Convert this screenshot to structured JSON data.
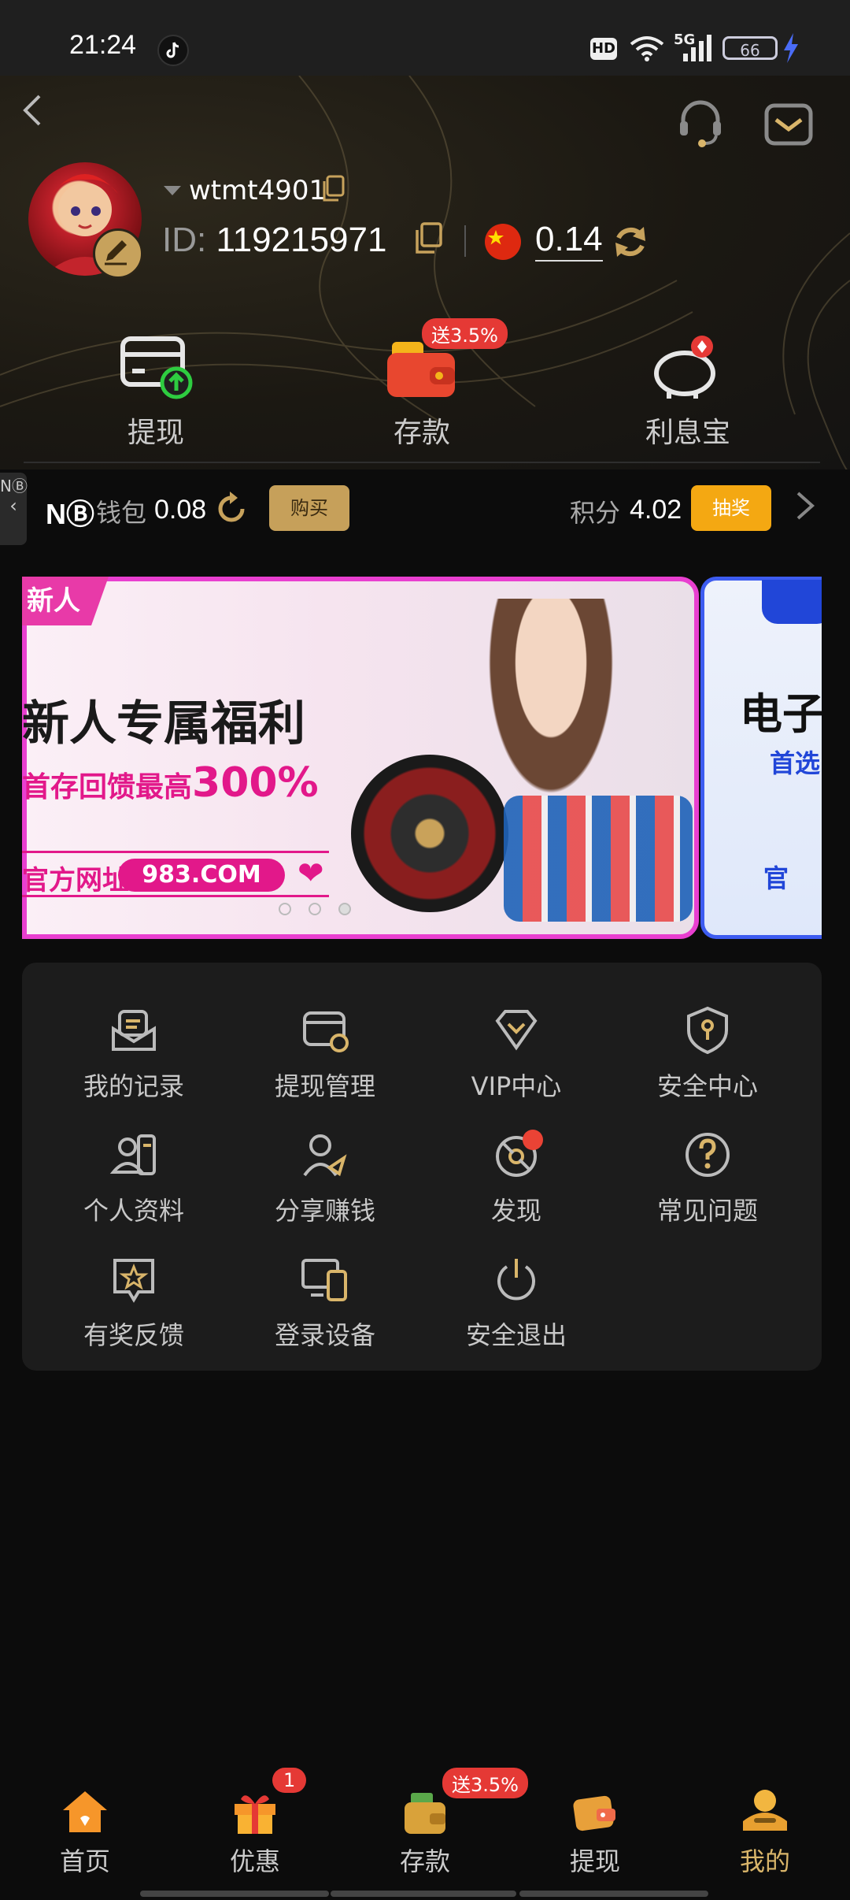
{
  "status_bar": {
    "time": "21:24",
    "hd": "HD",
    "network": "5G",
    "battery": "66"
  },
  "profile": {
    "username": "wtmt4901",
    "id_label": "ID:",
    "id_value": "119215971",
    "balance": "0.14"
  },
  "quick_actions": [
    {
      "label": "提现",
      "icon": "withdraw-card-icon"
    },
    {
      "label": "存款",
      "icon": "deposit-wallet-icon",
      "badge": "送3.5%"
    },
    {
      "label": "利息宝",
      "icon": "piggy-bank-icon"
    }
  ],
  "wallet": {
    "nb_logo": "NⒷ",
    "wallet_label": "钱包",
    "wallet_value": "0.08",
    "buy_label": "购买",
    "points_label": "积分",
    "points_value": "4.02",
    "lottery_label": "抽奖"
  },
  "side_tab": "NⒷ",
  "banner": {
    "tag": "新人",
    "title": "新人专属福利",
    "sub_prefix": "首存回馈最高",
    "sub_highlight": "300%",
    "url_label": "官方网址",
    "url": "983.COM",
    "banner2_title": "电子",
    "banner2_sub": "首选",
    "banner2_foot": "官"
  },
  "menu": [
    {
      "label": "我的记录",
      "icon": "records-icon"
    },
    {
      "label": "提现管理",
      "icon": "withdraw-manage-icon"
    },
    {
      "label": "VIP中心",
      "icon": "vip-diamond-icon"
    },
    {
      "label": "安全中心",
      "icon": "security-shield-icon"
    },
    {
      "label": "个人资料",
      "icon": "profile-card-icon"
    },
    {
      "label": "分享赚钱",
      "icon": "share-earn-icon"
    },
    {
      "label": "发现",
      "icon": "discover-icon"
    },
    {
      "label": "常见问题",
      "icon": "faq-question-icon"
    },
    {
      "label": "有奖反馈",
      "icon": "feedback-star-icon"
    },
    {
      "label": "登录设备",
      "icon": "devices-icon"
    },
    {
      "label": "安全退出",
      "icon": "power-icon"
    }
  ],
  "bottom_nav": [
    {
      "label": "首页",
      "icon": "home-icon"
    },
    {
      "label": "优惠",
      "icon": "gift-icon",
      "badge": "1"
    },
    {
      "label": "存款",
      "icon": "deposit-icon",
      "badge": "送3.5%"
    },
    {
      "label": "提现",
      "icon": "withdraw-icon"
    },
    {
      "label": "我的",
      "icon": "my-account-icon",
      "active": true
    }
  ],
  "colors": {
    "gold": "#d9b56a",
    "accent_red": "#e53935",
    "lottery_orange": "#f4a812"
  }
}
